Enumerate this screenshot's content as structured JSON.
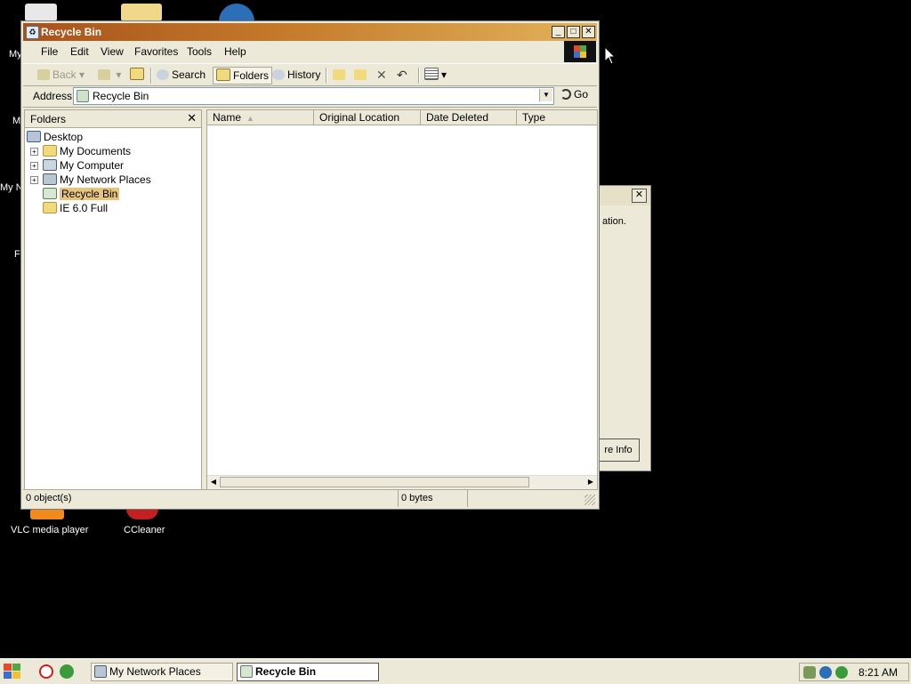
{
  "desktop": {
    "icons": [
      {
        "label": "VLC media player"
      },
      {
        "label": "CCleaner"
      }
    ],
    "partial_labels": [
      "My",
      "M",
      "My N",
      "F"
    ]
  },
  "bg_dialog": {
    "close_label": "✕",
    "text": "ation.",
    "button_label": "re Info"
  },
  "window": {
    "title": "Recycle Bin",
    "controls": {
      "minimize": "_",
      "maximize": "□",
      "close": "✕"
    },
    "menu": [
      "File",
      "Edit",
      "View",
      "Favorites",
      "Tools",
      "Help"
    ],
    "toolbar": {
      "back": "Back",
      "forward": "",
      "search": "Search",
      "folders": "Folders",
      "history": "History"
    },
    "address": {
      "label": "Address",
      "value": "Recycle Bin",
      "go": "Go"
    },
    "folders_pane": {
      "title": "Folders",
      "close": "✕",
      "tree": [
        {
          "label": "Desktop",
          "icon": "desktop-icon",
          "level": 0,
          "expandable": false,
          "selected": false
        },
        {
          "label": "My Documents",
          "icon": "my-documents-icon",
          "level": 1,
          "expandable": true,
          "selected": false
        },
        {
          "label": "My Computer",
          "icon": "my-computer-icon",
          "level": 1,
          "expandable": true,
          "selected": false
        },
        {
          "label": "My Network Places",
          "icon": "network-places-icon",
          "level": 1,
          "expandable": true,
          "selected": false
        },
        {
          "label": "Recycle Bin",
          "icon": "recycle-bin-icon",
          "level": 1,
          "expandable": false,
          "selected": true
        },
        {
          "label": "IE 6.0 Full",
          "icon": "folder-icon",
          "level": 1,
          "expandable": false,
          "selected": false
        }
      ]
    },
    "details": {
      "columns": [
        "Name",
        "Original Location",
        "Date Deleted",
        "Type"
      ],
      "sort_indicator": "▲",
      "rows": []
    },
    "status": {
      "objects": "0 object(s)",
      "size": "0 bytes"
    }
  },
  "taskbar": {
    "buttons": [
      {
        "label": "My Network Places",
        "active": false
      },
      {
        "label": "Recycle Bin",
        "active": true
      }
    ],
    "clock": "8:21 AM"
  },
  "colors": {
    "titlebar_start": "#a8521c",
    "titlebar_end": "#e2b35a",
    "window_bg": "#ece9d8",
    "selection": "#e6c47a"
  }
}
